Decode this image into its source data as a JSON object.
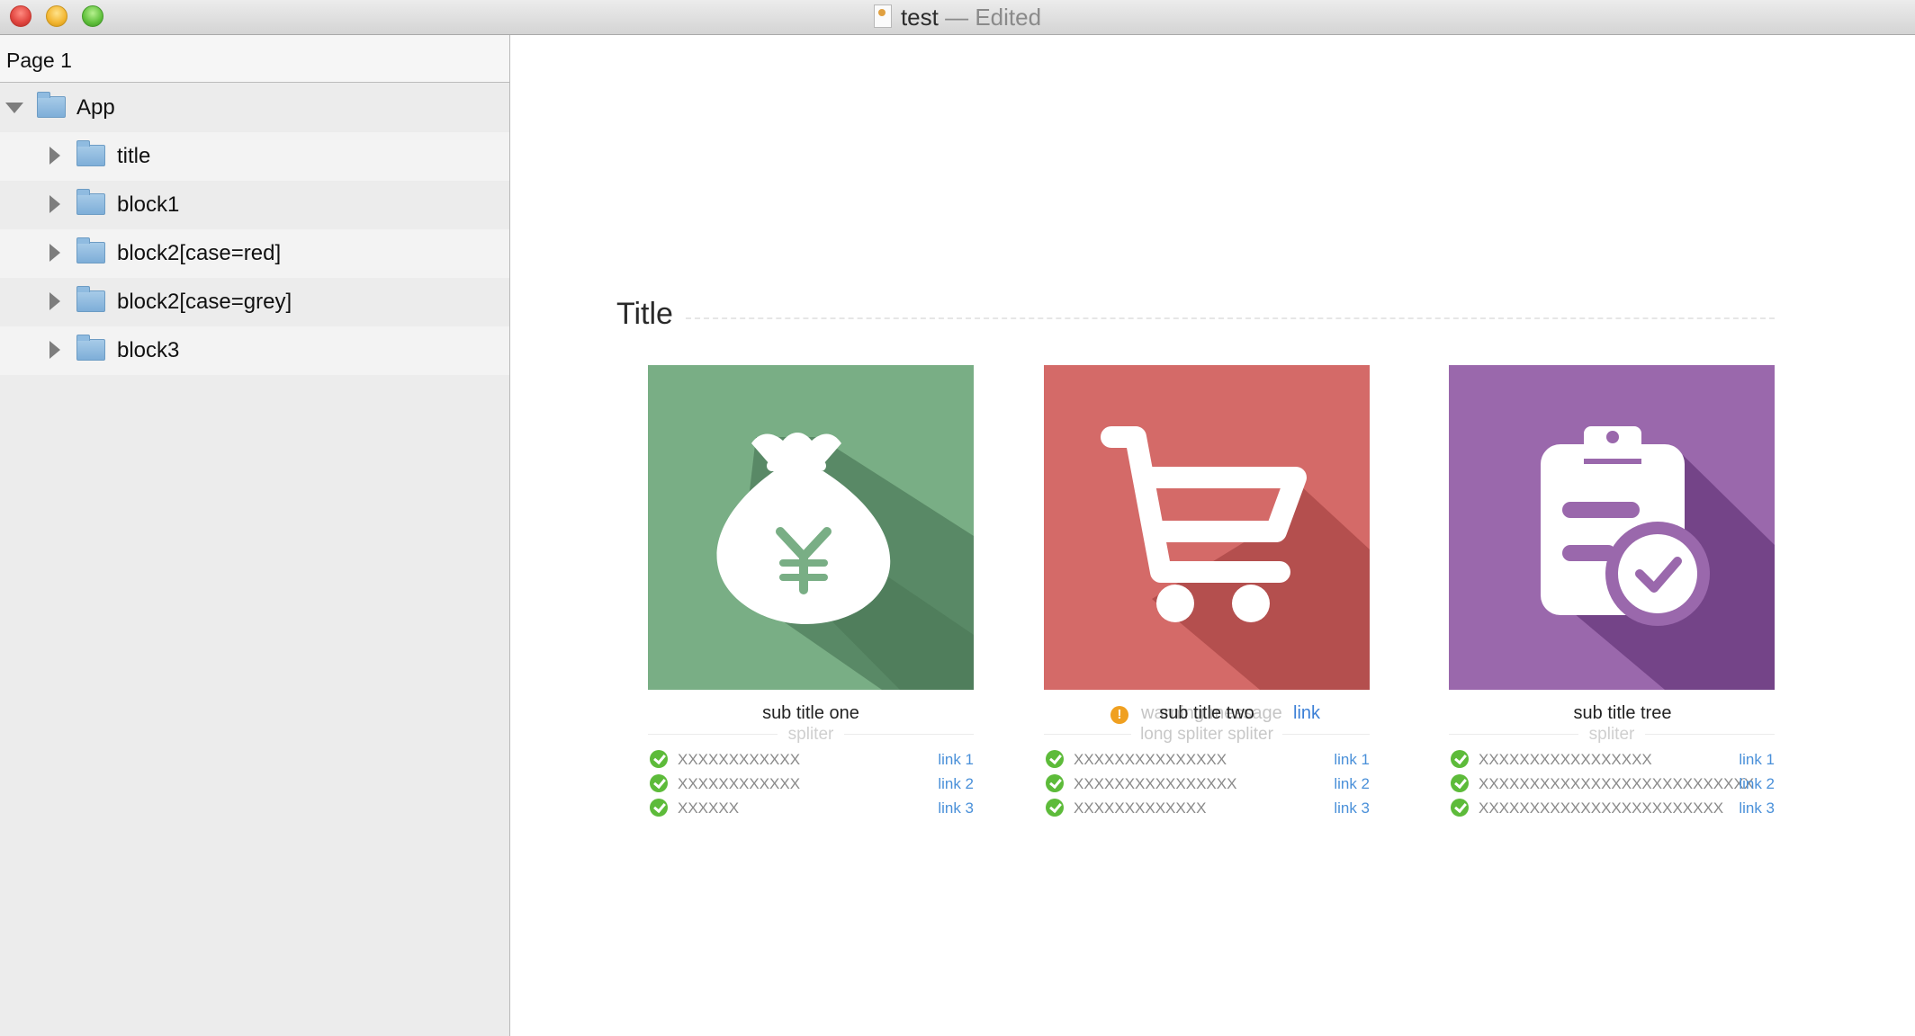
{
  "window": {
    "title": "test",
    "status": "— Edited"
  },
  "sidebar": {
    "header": "Page 1",
    "root": {
      "label": "App",
      "expanded": true
    },
    "items": [
      {
        "label": "title"
      },
      {
        "label": "block1"
      },
      {
        "label": "block2[case=red]"
      },
      {
        "label": "block2[case=grey]"
      },
      {
        "label": "block3"
      }
    ]
  },
  "main": {
    "title": "Title",
    "cards": [
      {
        "color": "#79ae85",
        "icon": "money-bag-yen-icon",
        "subtitle": "sub title one",
        "spliter": "spliter",
        "items": [
          {
            "text": "XXXXXXXXXXXX",
            "link": "link 1"
          },
          {
            "text": "XXXXXXXXXXXX",
            "link": "link 2"
          },
          {
            "text": "XXXXXX",
            "link": "link 3"
          }
        ]
      },
      {
        "color": "#d46a68",
        "icon": "shopping-cart-icon",
        "subtitle": "sub title two",
        "warning_text": "warning message",
        "warning_link": "link",
        "spliter": "long spliter spliter",
        "items": [
          {
            "text": "XXXXXXXXXXXXXXX",
            "link": "link 1"
          },
          {
            "text": "XXXXXXXXXXXXXXXX",
            "link": "link 2"
          },
          {
            "text": "XXXXXXXXXXXXX",
            "link": "link 3"
          }
        ]
      },
      {
        "color": "#9a68ac",
        "icon": "clipboard-check-icon",
        "subtitle": "sub title tree",
        "spliter": "spliter",
        "items": [
          {
            "text": "XXXXXXXXXXXXXXXXX",
            "link": "link 1"
          },
          {
            "text": "XXXXXXXXXXXXXXXXXXXXXXXXXXX",
            "link": "link 2"
          },
          {
            "text": "XXXXXXXXXXXXXXXXXXXXXXXX",
            "link": "link 3"
          }
        ]
      }
    ]
  }
}
